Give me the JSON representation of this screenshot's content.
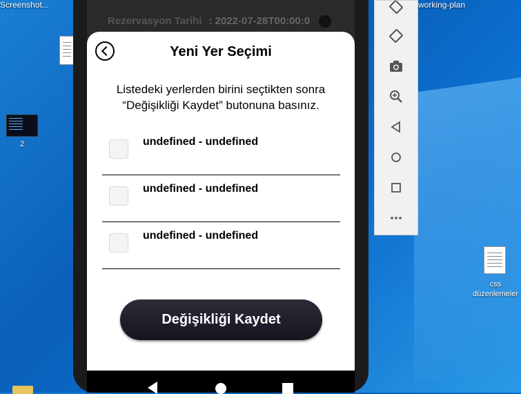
{
  "desktop": {
    "icons": [
      {
        "label": "Screenshot..."
      },
      {
        "label": "2"
      },
      {
        "label": "working-plan"
      },
      {
        "label": "css düzenlemeler"
      }
    ]
  },
  "background_row": {
    "label": "Rezervasyon Tarihi",
    "value": ": 2022-07-28T00:00:0"
  },
  "modal": {
    "title": "Yeni Yer Seçimi",
    "instructions_line1": "Listedeki yerlerden birini seçtikten sonra",
    "instructions_line2": "“Değişikliği Kaydet” butonuna basınız.",
    "items": [
      {
        "label": "undefined - undefined",
        "checked": false
      },
      {
        "label": "undefined - undefined",
        "checked": false
      },
      {
        "label": "undefined - undefined",
        "checked": false
      }
    ],
    "save_label": "Değişikliği Kaydet"
  },
  "emulator_toolbar": {
    "tools": [
      "rotate-left-icon",
      "rotate-right-icon",
      "camera-icon",
      "zoom-icon",
      "back-icon",
      "home-icon",
      "overview-icon",
      "more-icon"
    ]
  },
  "colors": {
    "desktop_blue": "#0a5fb8",
    "button_dark": "#1f1f2a",
    "checkbox_bg": "#f6f3f6"
  }
}
